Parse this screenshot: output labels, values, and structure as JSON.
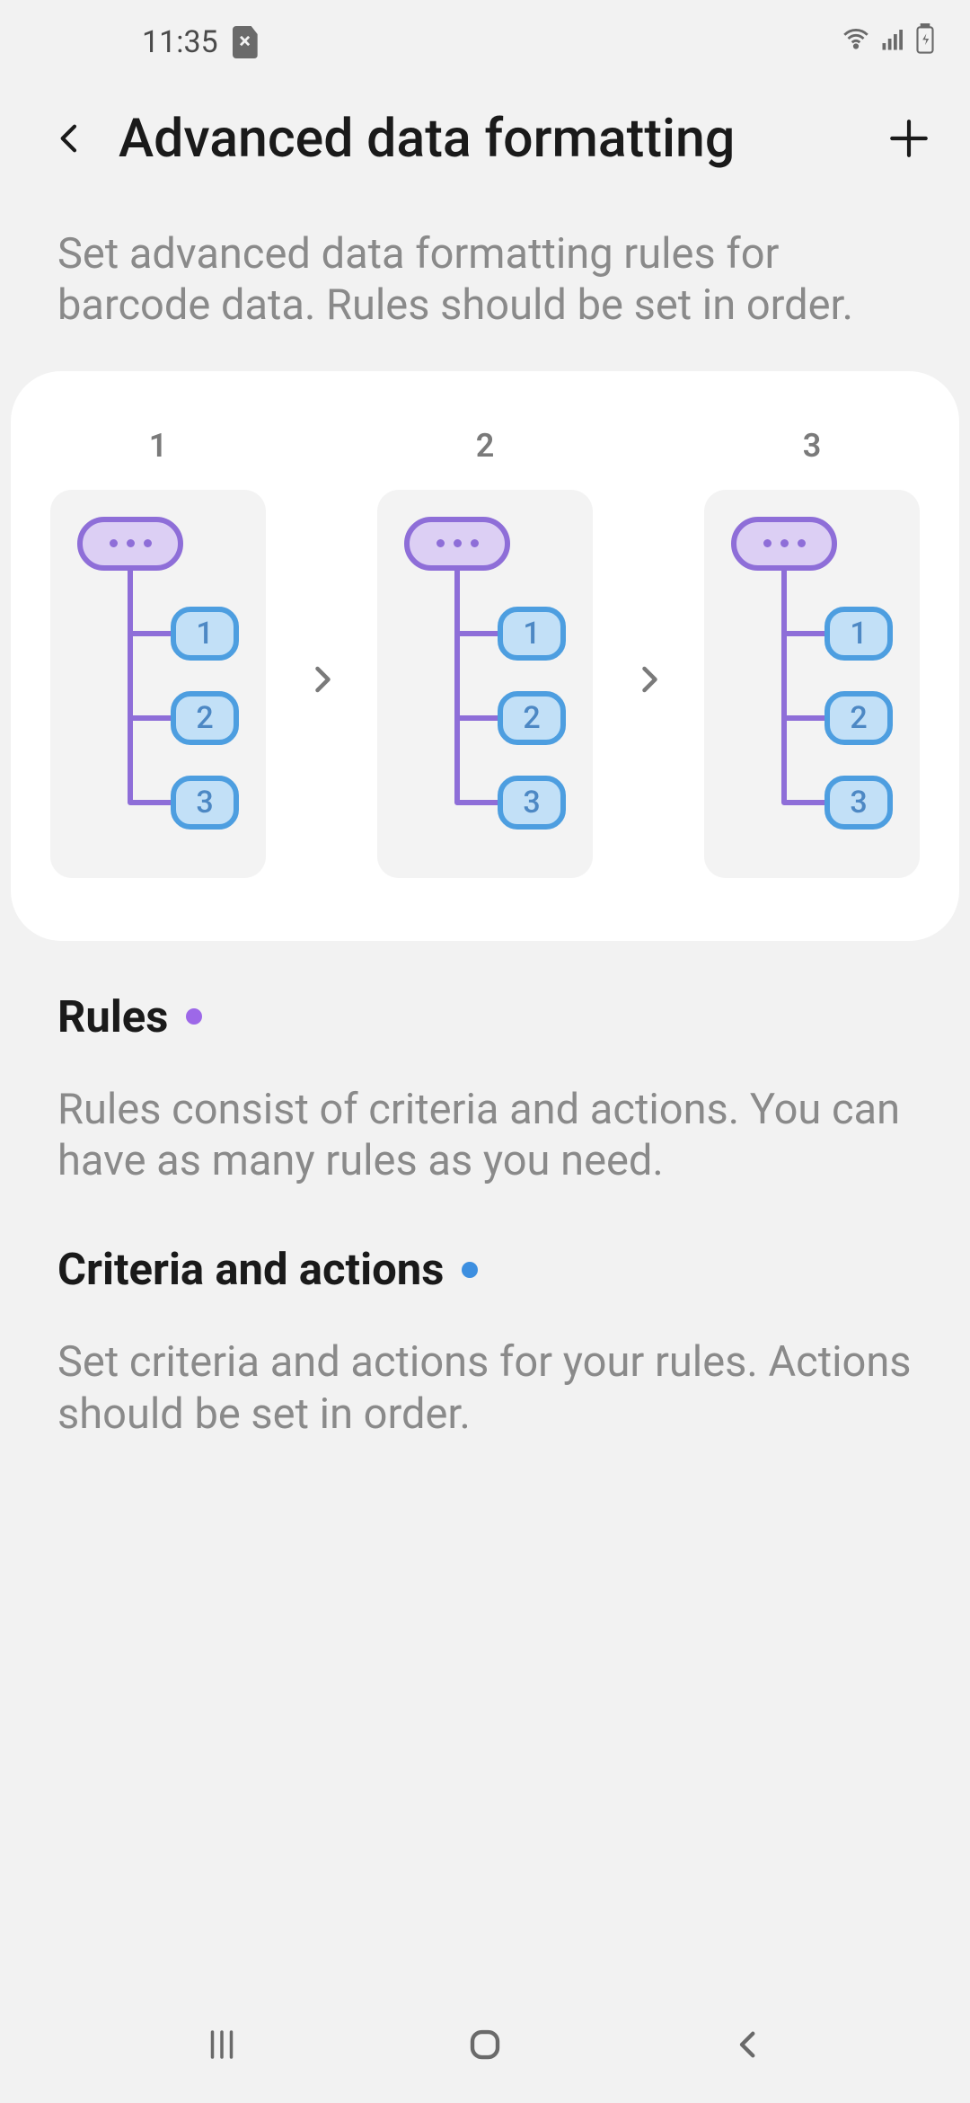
{
  "status": {
    "time": "11:35"
  },
  "header": {
    "title": "Advanced data formatting"
  },
  "subtitle": "Set advanced data formatting rules for barcode data. Rules should be set in order.",
  "diagram": {
    "cols": [
      {
        "num": "1",
        "nodes": [
          "1",
          "2",
          "3"
        ]
      },
      {
        "num": "2",
        "nodes": [
          "1",
          "2",
          "3"
        ]
      },
      {
        "num": "3",
        "nodes": [
          "1",
          "2",
          "3"
        ]
      }
    ]
  },
  "sections": {
    "rules": {
      "title": "Rules",
      "desc": "Rules consist of criteria and actions. You can have as many rules as you need."
    },
    "criteria": {
      "title": "Criteria and actions",
      "desc": "Set criteria and actions for your rules. Actions should be set in order."
    }
  }
}
